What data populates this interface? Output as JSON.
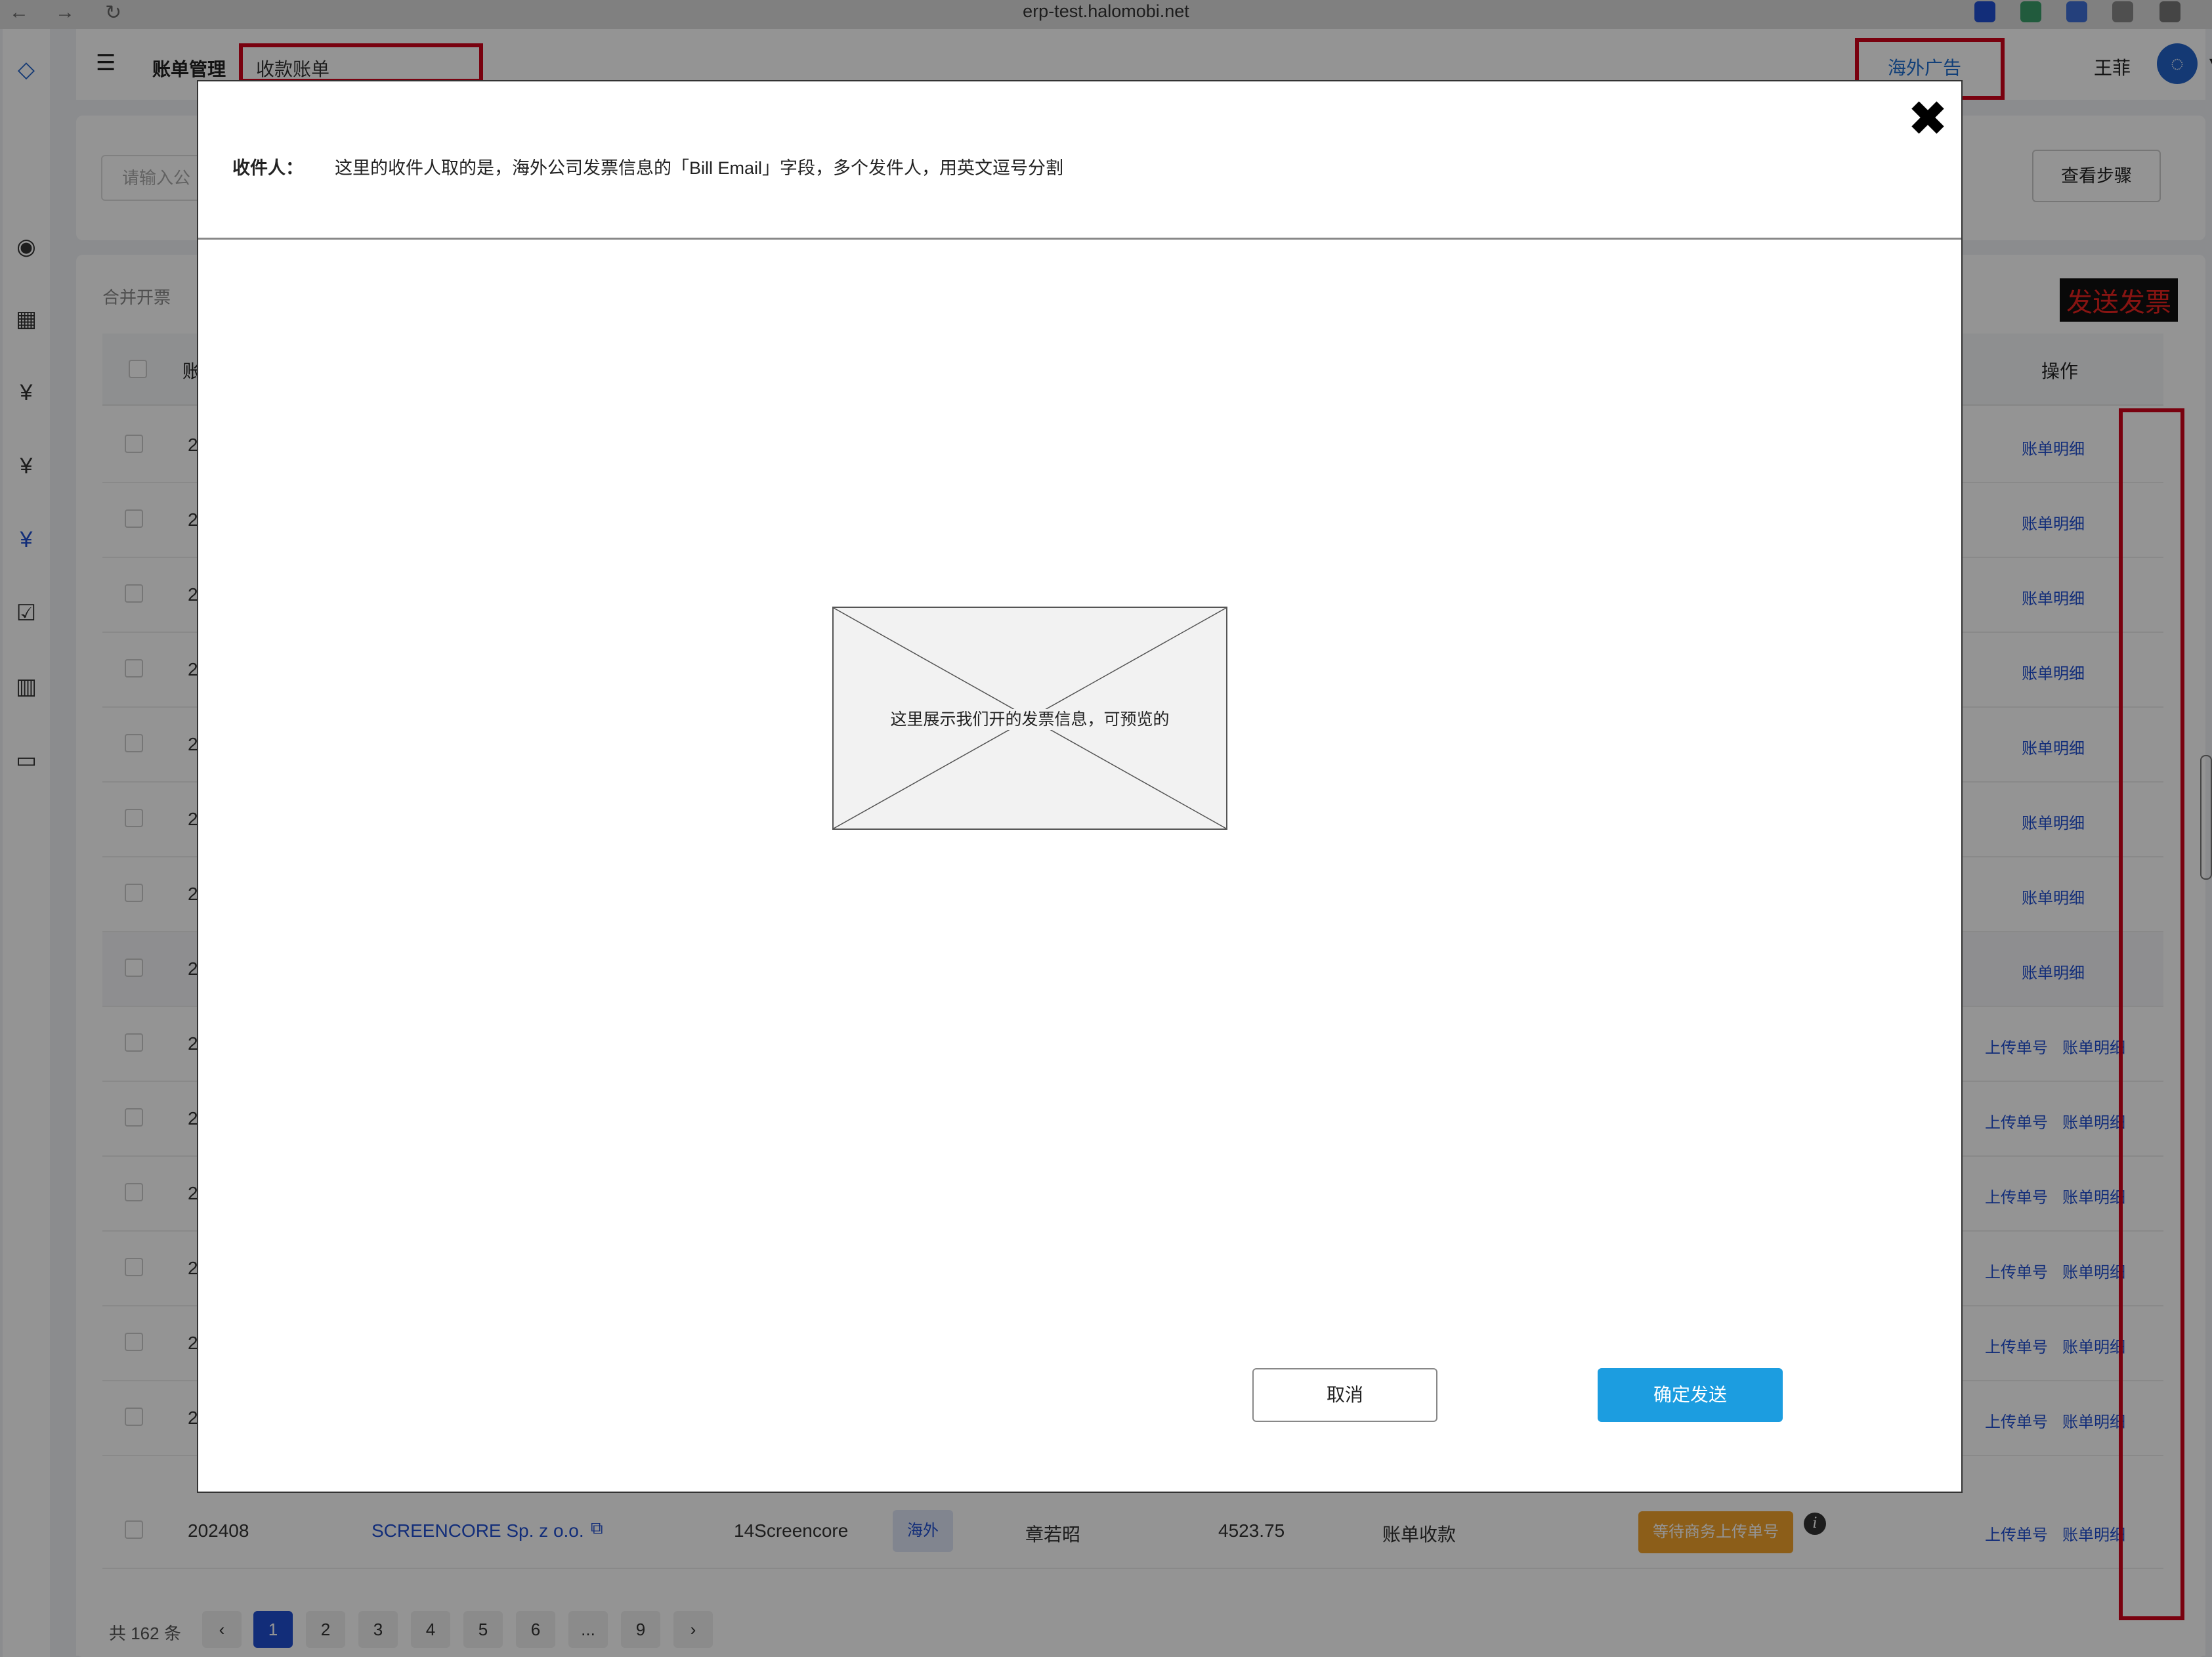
{
  "browser": {
    "url": "erp-test.halomobi.net",
    "back": "←",
    "forward": "→",
    "reload": "↻"
  },
  "header": {
    "breadcrumb_parent": "账单管理",
    "breadcrumb_current": "收款账单",
    "org_selector": "海外广告",
    "user_name": "王菲"
  },
  "search": {
    "placeholder": "请输入公",
    "steps_button": "查看步骤"
  },
  "table": {
    "merge_label": "合并开票",
    "send_invoice_label": "发送发票",
    "col_account_partial": "账",
    "col_actions": "操作",
    "row_id_partial": "2",
    "action_detail": "账单明细",
    "action_upload": "上传单号",
    "action_detail_clipped": "账单明细",
    "last_row": {
      "id": "202408",
      "account": "SCREENCORE Sp. z o.o.",
      "code": "14Screencore",
      "tag": "海外",
      "owner": "章若昭",
      "amount": "4523.75",
      "type": "账单收款",
      "status": "等待商务上传单号"
    }
  },
  "pagination": {
    "total": "共 162 条",
    "pages": [
      "1",
      "2",
      "3",
      "4",
      "5",
      "6",
      "...",
      "9"
    ],
    "current": "1"
  },
  "modal": {
    "recipient_label": "收件人：",
    "recipient_note": "这里的收件人取的是，海外公司发票信息的「Bill Email」字段，多个发件人，用英文逗号分割",
    "preview_text": "这里展示我们开的发票信息，可预览的",
    "cancel_button": "取消",
    "confirm_button": "确定发送"
  },
  "colors": {
    "accent": "#1c9de0",
    "link": "#1f4fd1",
    "highlight_box": "#d0021b",
    "status": "#f2a22b"
  }
}
